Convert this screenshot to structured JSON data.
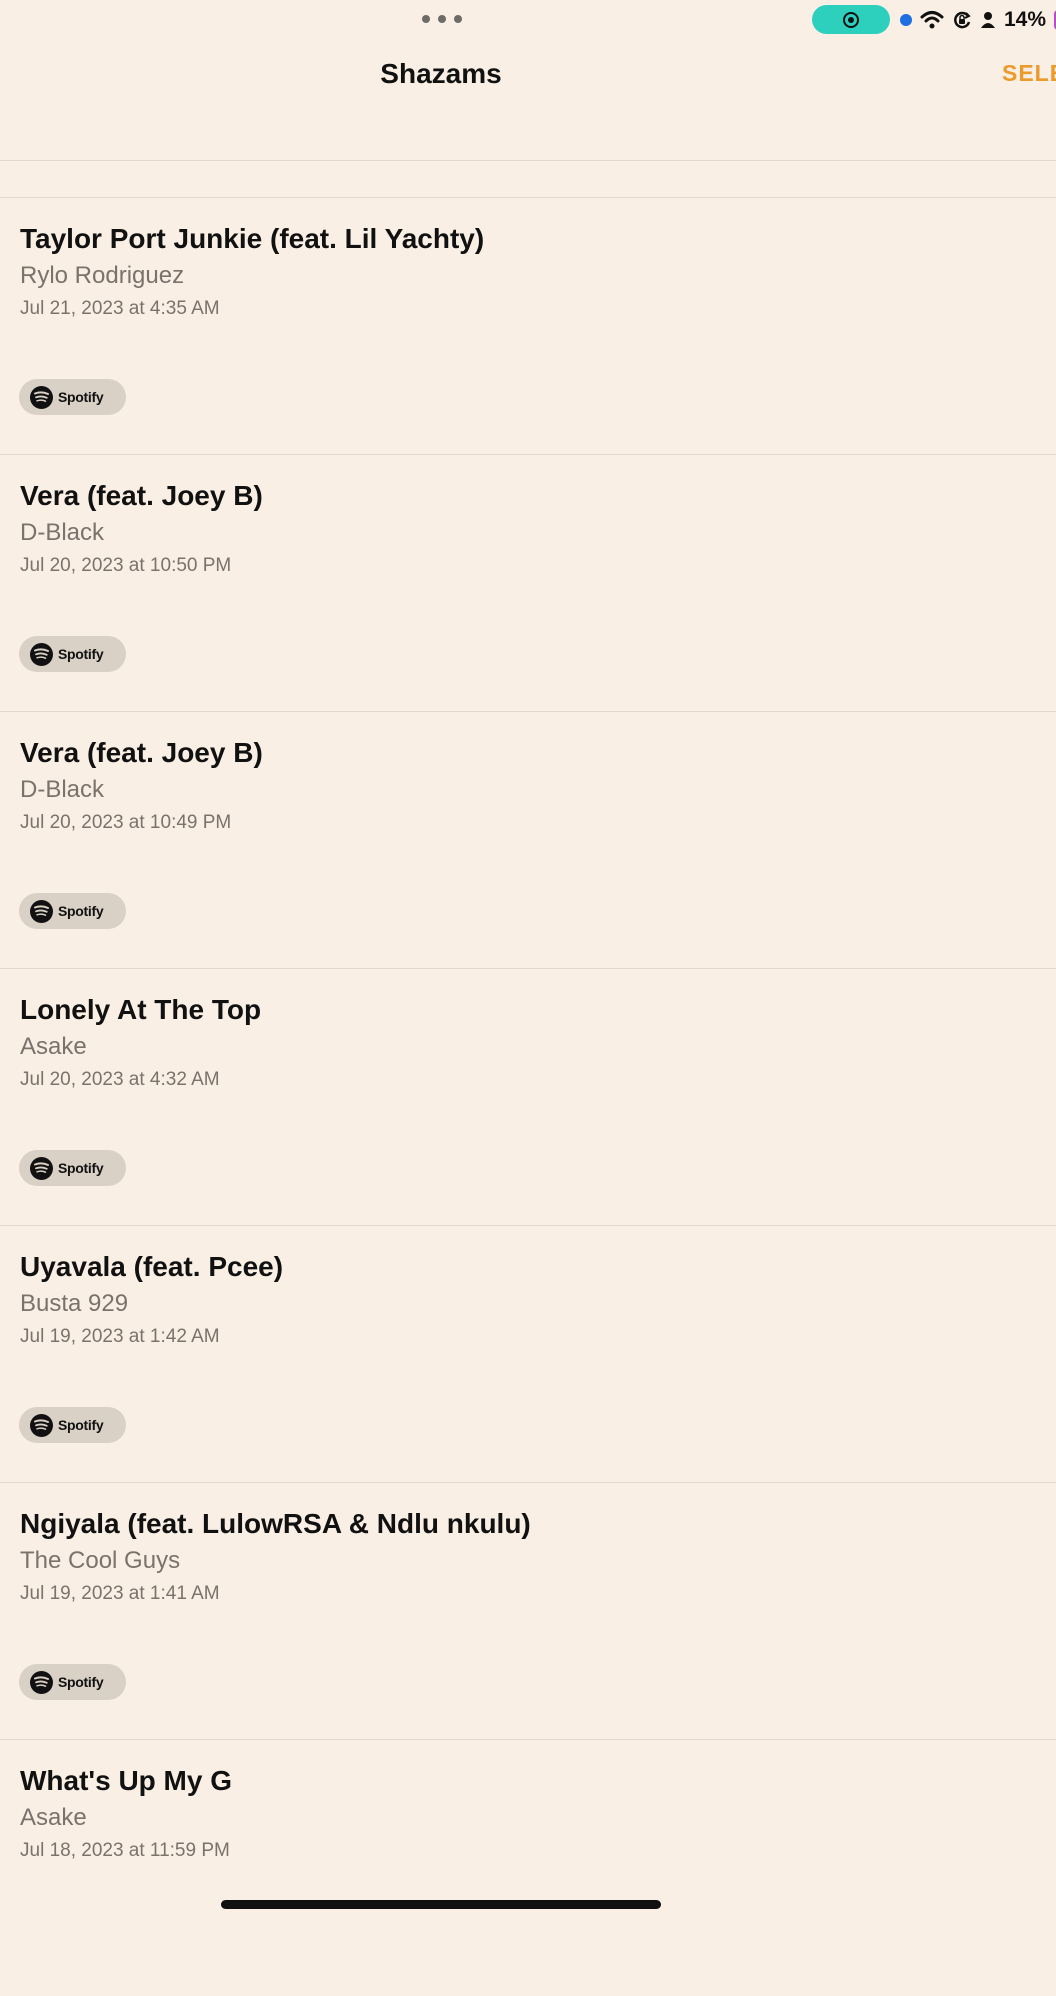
{
  "status_bar": {
    "battery_percent": "14%",
    "icons": [
      "multitasking-dots-icon",
      "screen-record-icon",
      "microphone-indicator",
      "wifi-icon",
      "orientation-lock-icon",
      "person-icon",
      "battery-icon"
    ],
    "colors": {
      "record_pill": "#2dcfbd",
      "mic_dot": "#1f6fe0",
      "battery": "#b44fc4"
    }
  },
  "header": {
    "title": "Shazams",
    "select_label": "SELE"
  },
  "spotify_label": "Spotify",
  "colors": {
    "background": "#f9efe5",
    "accent": "#eb9a2c",
    "secondary_text": "#7a736c"
  },
  "items": [
    {
      "title": "Taylor Port Junkie (feat. Lil Yachty)",
      "artist": "Rylo Rodriguez",
      "date": "Jul 21, 2023 at 4:35 AM",
      "service": "Spotify"
    },
    {
      "title": "Vera (feat. Joey B)",
      "artist": "D-Black",
      "date": "Jul 20, 2023 at 10:50 PM",
      "service": "Spotify"
    },
    {
      "title": "Vera (feat. Joey B)",
      "artist": "D-Black",
      "date": "Jul 20, 2023 at 10:49 PM",
      "service": "Spotify"
    },
    {
      "title": "Lonely At The Top",
      "artist": "Asake",
      "date": "Jul 20, 2023 at 4:32 AM",
      "service": "Spotify"
    },
    {
      "title": "Uyavala (feat. Pcee)",
      "artist": "Busta 929",
      "date": "Jul 19, 2023 at 1:42 AM",
      "service": "Spotify"
    },
    {
      "title": "Ngiyala (feat. LulowRSA & Ndlu nkulu)",
      "artist": "The Cool Guys",
      "date": "Jul 19, 2023 at 1:41 AM",
      "service": "Spotify"
    },
    {
      "title": "What's Up My G",
      "artist": "Asake",
      "date": "Jul 18, 2023 at 11:59 PM"
    }
  ]
}
